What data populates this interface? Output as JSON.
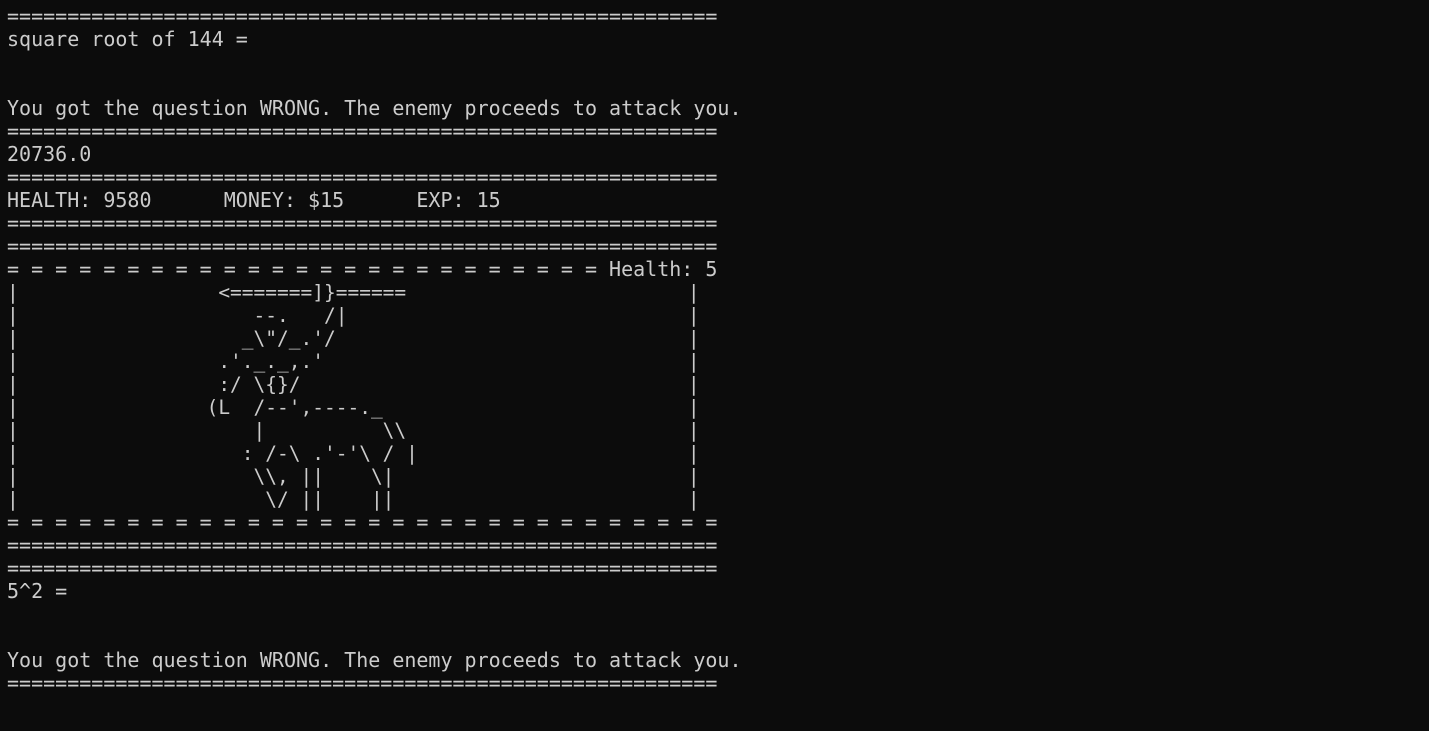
{
  "terminal": {
    "lines": [
      "===========================================================",
      "square root of 144 =",
      "",
      "",
      "You got the question WRONG. The enemy proceeds to attack you.",
      "===========================================================",
      "20736.0",
      "===========================================================",
      "HEALTH: 9580      MONEY: $15      EXP: 15",
      "===========================================================",
      "===========================================================",
      "= = = = = = = = = = = = = = = = = = = = = = = = = Health: 5",
      "|                 <=======]}======                        |",
      "|                    --.   /|                             |",
      "|                   _\\\"/_.'/                              |",
      "|                 .'._._,.'                               |",
      "|                 :/ \\{}/                                 |",
      "|                (L  /--',----._                          |",
      "|                    |          \\\\                        |",
      "|                   : /-\\ .'-'\\ / |                       |",
      "|                    \\\\, ||    \\|                         |",
      "|                     \\/ ||    ||                         |",
      "= = = = = = = = = = = = = = = = = = = = = = = = = = = = = =",
      "===========================================================",
      "===========================================================",
      "5^2 =",
      "",
      "",
      "You got the question WRONG. The enemy proceeds to attack you.",
      "==========================================================="
    ]
  }
}
